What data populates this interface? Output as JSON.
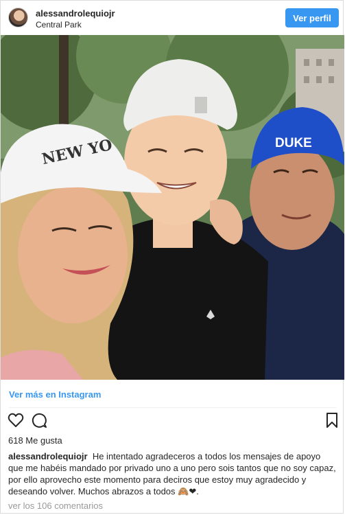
{
  "header": {
    "username": "alessandrolequiojr",
    "location": "Central Park",
    "follow_label": "Ver perfil"
  },
  "photo": {
    "hat_text_left": "NEW YO",
    "hat_text_right": "DUKE"
  },
  "post": {
    "view_more": "Ver más en Instagram",
    "likes": "618 Me gusta",
    "caption_user": "alessandrolequiojr",
    "caption_text": "He intentado agradeceros a todos los mensajes de apoyo que me habéis mandado por privado uno a uno pero sois tantos que no soy capaz, por ello aprovecho este momento para deciros que estoy muy agradecido y deseando volver. Muchos abrazos a todos 🙈❤.",
    "comments": "ver los 106 comentarios"
  },
  "icons": {
    "like": "heart-icon",
    "comment": "comment-bubble-icon",
    "save": "bookmark-icon"
  }
}
